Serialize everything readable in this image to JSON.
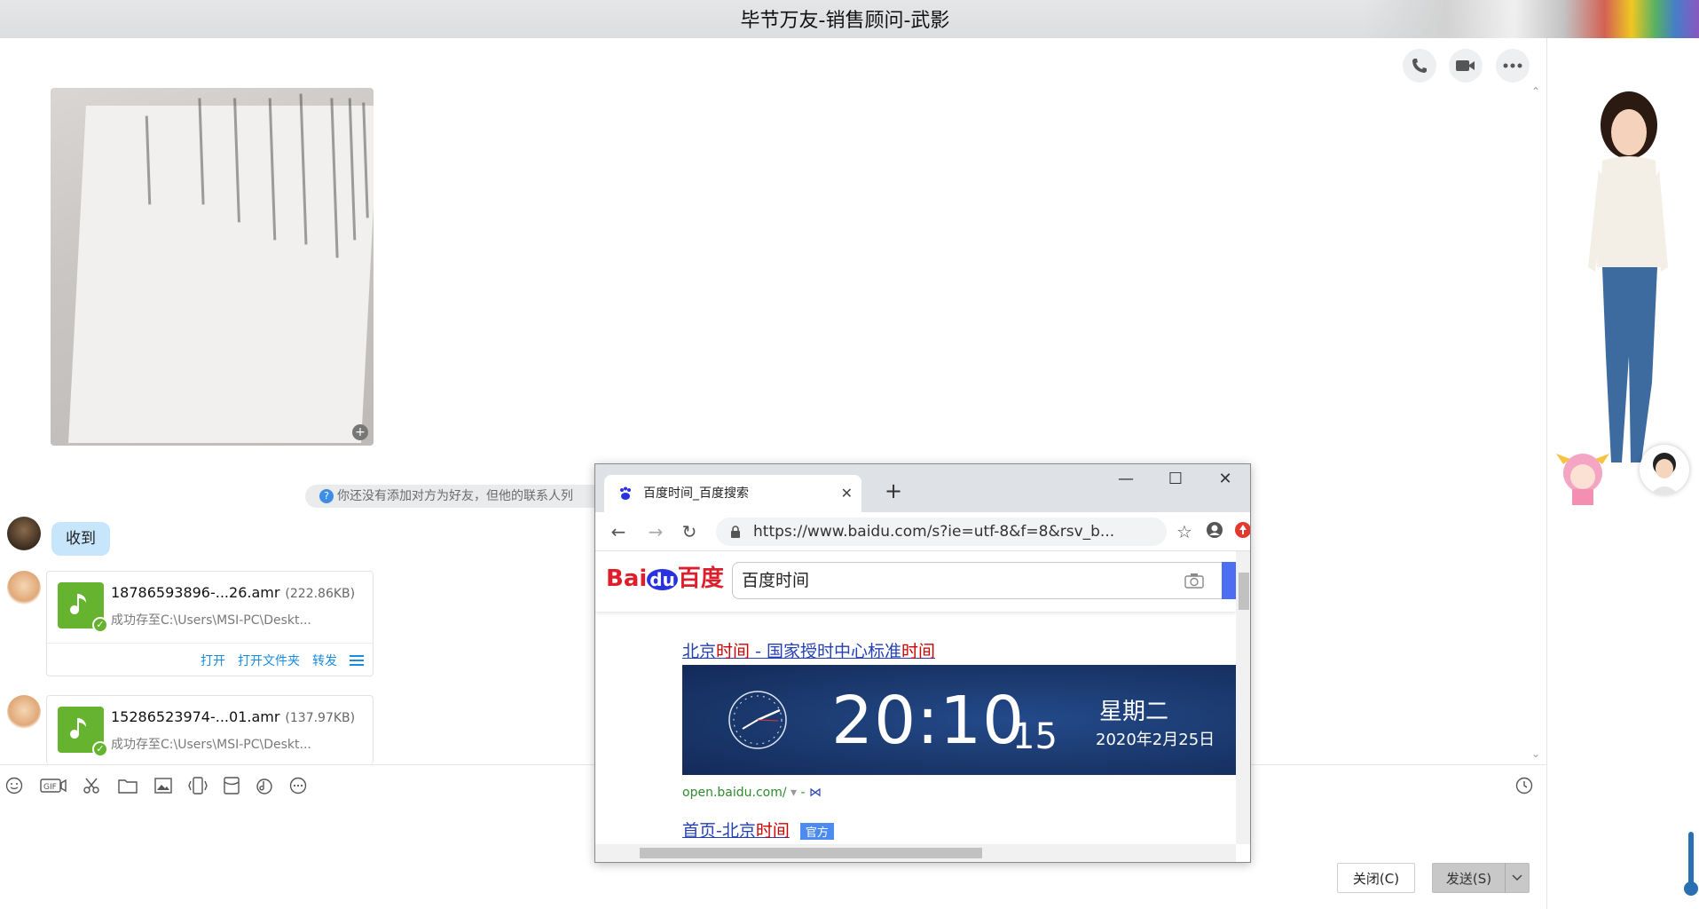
{
  "window": {
    "title": "毕节万友-销售顾问-武影"
  },
  "chat": {
    "notice": "你还没有添加对方为好友，但他的联系人列",
    "received_message": "收到",
    "files": [
      {
        "name": "18786593896-...26.amr",
        "size": "(222.86KB)",
        "path": "成功存至C:\\Users\\MSI-PC\\Deskt...",
        "actions": [
          "打开",
          "打开文件夹",
          "转发"
        ]
      },
      {
        "name": "15286523974-...01.amr",
        "size": "(137.97KB)",
        "path": "成功存至C:\\Users\\MSI-PC\\Deskt..."
      }
    ],
    "buttons": {
      "close": "关闭(C)",
      "send": "发送(S)"
    }
  },
  "browser": {
    "tab_title": "百度时间_百度搜索",
    "url": "https://www.baidu.com/s?ie=utf-8&f=8&rsv_b...",
    "search_query": "百度时间",
    "logo_bai": "Bai",
    "logo_du": "du",
    "logo_cn": "百度",
    "result1": {
      "p1": "北京",
      "hl1": "时间",
      "p2": " - 国家授时中心标准",
      "hl2": "时间"
    },
    "clock": {
      "time": "20:10",
      "seconds": "15",
      "weekday": "星期二",
      "date": "2020年2月25日"
    },
    "site": "open.baidu.com/",
    "result2": {
      "p1": "首页-北京",
      "hl1": "时间",
      "tag": "官方"
    }
  },
  "colors": {
    "accent_blue": "#1a8be0",
    "file_green": "#65b32e",
    "baidu_blue": "#4e6ef2",
    "baidu_red": "#de1e2b"
  }
}
